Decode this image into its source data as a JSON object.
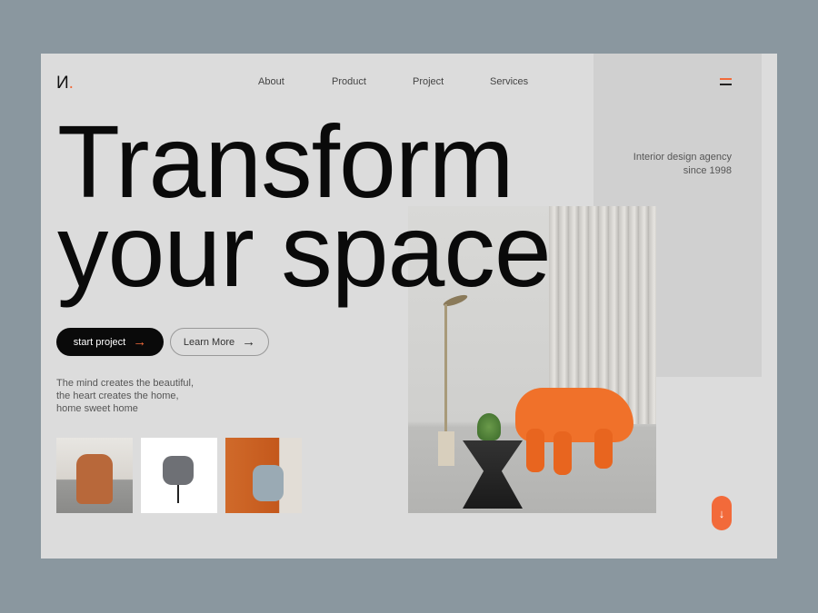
{
  "brand": {
    "logo": "И",
    "logo_dot": "."
  },
  "nav": {
    "items": [
      "About",
      "Product",
      "Project",
      "Services"
    ]
  },
  "side": {
    "tagline_1": "Interior design agency",
    "tagline_2": "since 1998"
  },
  "hero": {
    "line1": "Transform",
    "line2": "your space",
    "primary_button": "start project",
    "secondary_button": "Learn More",
    "arrow": "→",
    "description": "The mind creates the beautiful, the heart creates the home, home sweet home"
  },
  "scroll": {
    "icon": "↓"
  },
  "colors": {
    "accent": "#f26a3a",
    "background": "#dcdcdc",
    "frame": "#8a979f"
  }
}
